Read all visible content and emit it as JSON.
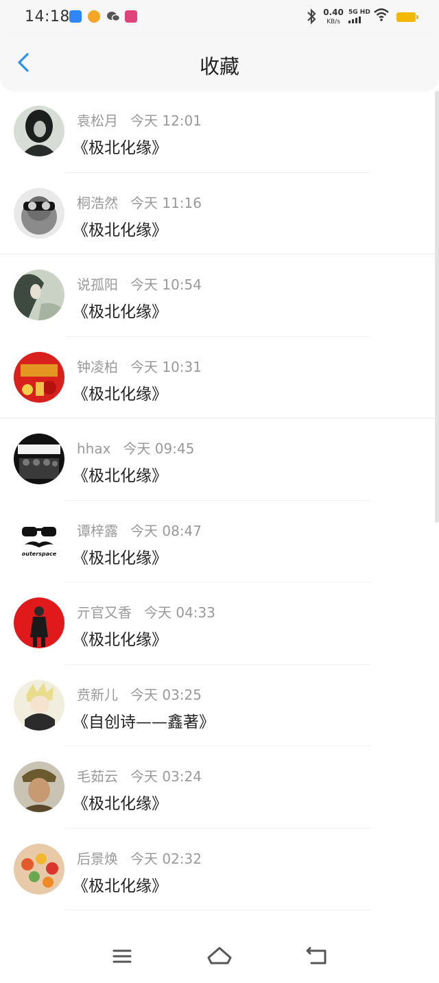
{
  "status_bar": {
    "time": "14:18",
    "net_speed": "0.40",
    "net_unit": "KB/s",
    "signal_label": "5G HD",
    "app_icons": [
      {
        "name": "app-icon-blue",
        "color": "#2f86f6"
      },
      {
        "name": "weibo-icon",
        "color": "#f5a623"
      },
      {
        "name": "wechat-icon",
        "color": "#555555"
      },
      {
        "name": "app-icon-pink",
        "color": "#e0437a"
      }
    ]
  },
  "header": {
    "title": "收藏",
    "accent": "#2a8ff7"
  },
  "favorites": [
    {
      "user": "袁松月",
      "time": "今天 12:01",
      "work": "《极北化缘》",
      "avatar": "dark-portrait"
    },
    {
      "user": "桐浩然",
      "time": "今天 11:16",
      "work": "《极北化缘》",
      "avatar": "glasses-monkey"
    },
    {
      "user": "说孤阳",
      "time": "今天 10:54",
      "work": "《极北化缘》",
      "avatar": "ink-portrait"
    },
    {
      "user": "钟凌柏",
      "time": "今天 10:31",
      "work": "《极北化缘》",
      "avatar": "red-festival"
    },
    {
      "user": "hhax",
      "time": "今天 09:45",
      "work": "《极北化缘》",
      "avatar": "band-photo"
    },
    {
      "user": "谭梓露",
      "time": "今天 08:47",
      "work": "《极北化缘》",
      "avatar": "mustache-logo",
      "avatar_text": "outerspace"
    },
    {
      "user": "亓官又香",
      "time": "今天 04:33",
      "work": "《极北化缘》",
      "avatar": "red-figure"
    },
    {
      "user": "贲新儿",
      "time": "今天 03:25",
      "work": "《自创诗——鑫著》",
      "avatar": "anime-character"
    },
    {
      "user": "毛茹云",
      "time": "今天 03:24",
      "work": "《极北化缘》",
      "avatar": "soldier"
    },
    {
      "user": "后景焕",
      "time": "今天 02:32",
      "work": "《极北化缘》",
      "avatar": "colorful-food"
    }
  ],
  "nav": {
    "menu": "menu-icon",
    "home": "home-icon",
    "back": "back-icon"
  }
}
